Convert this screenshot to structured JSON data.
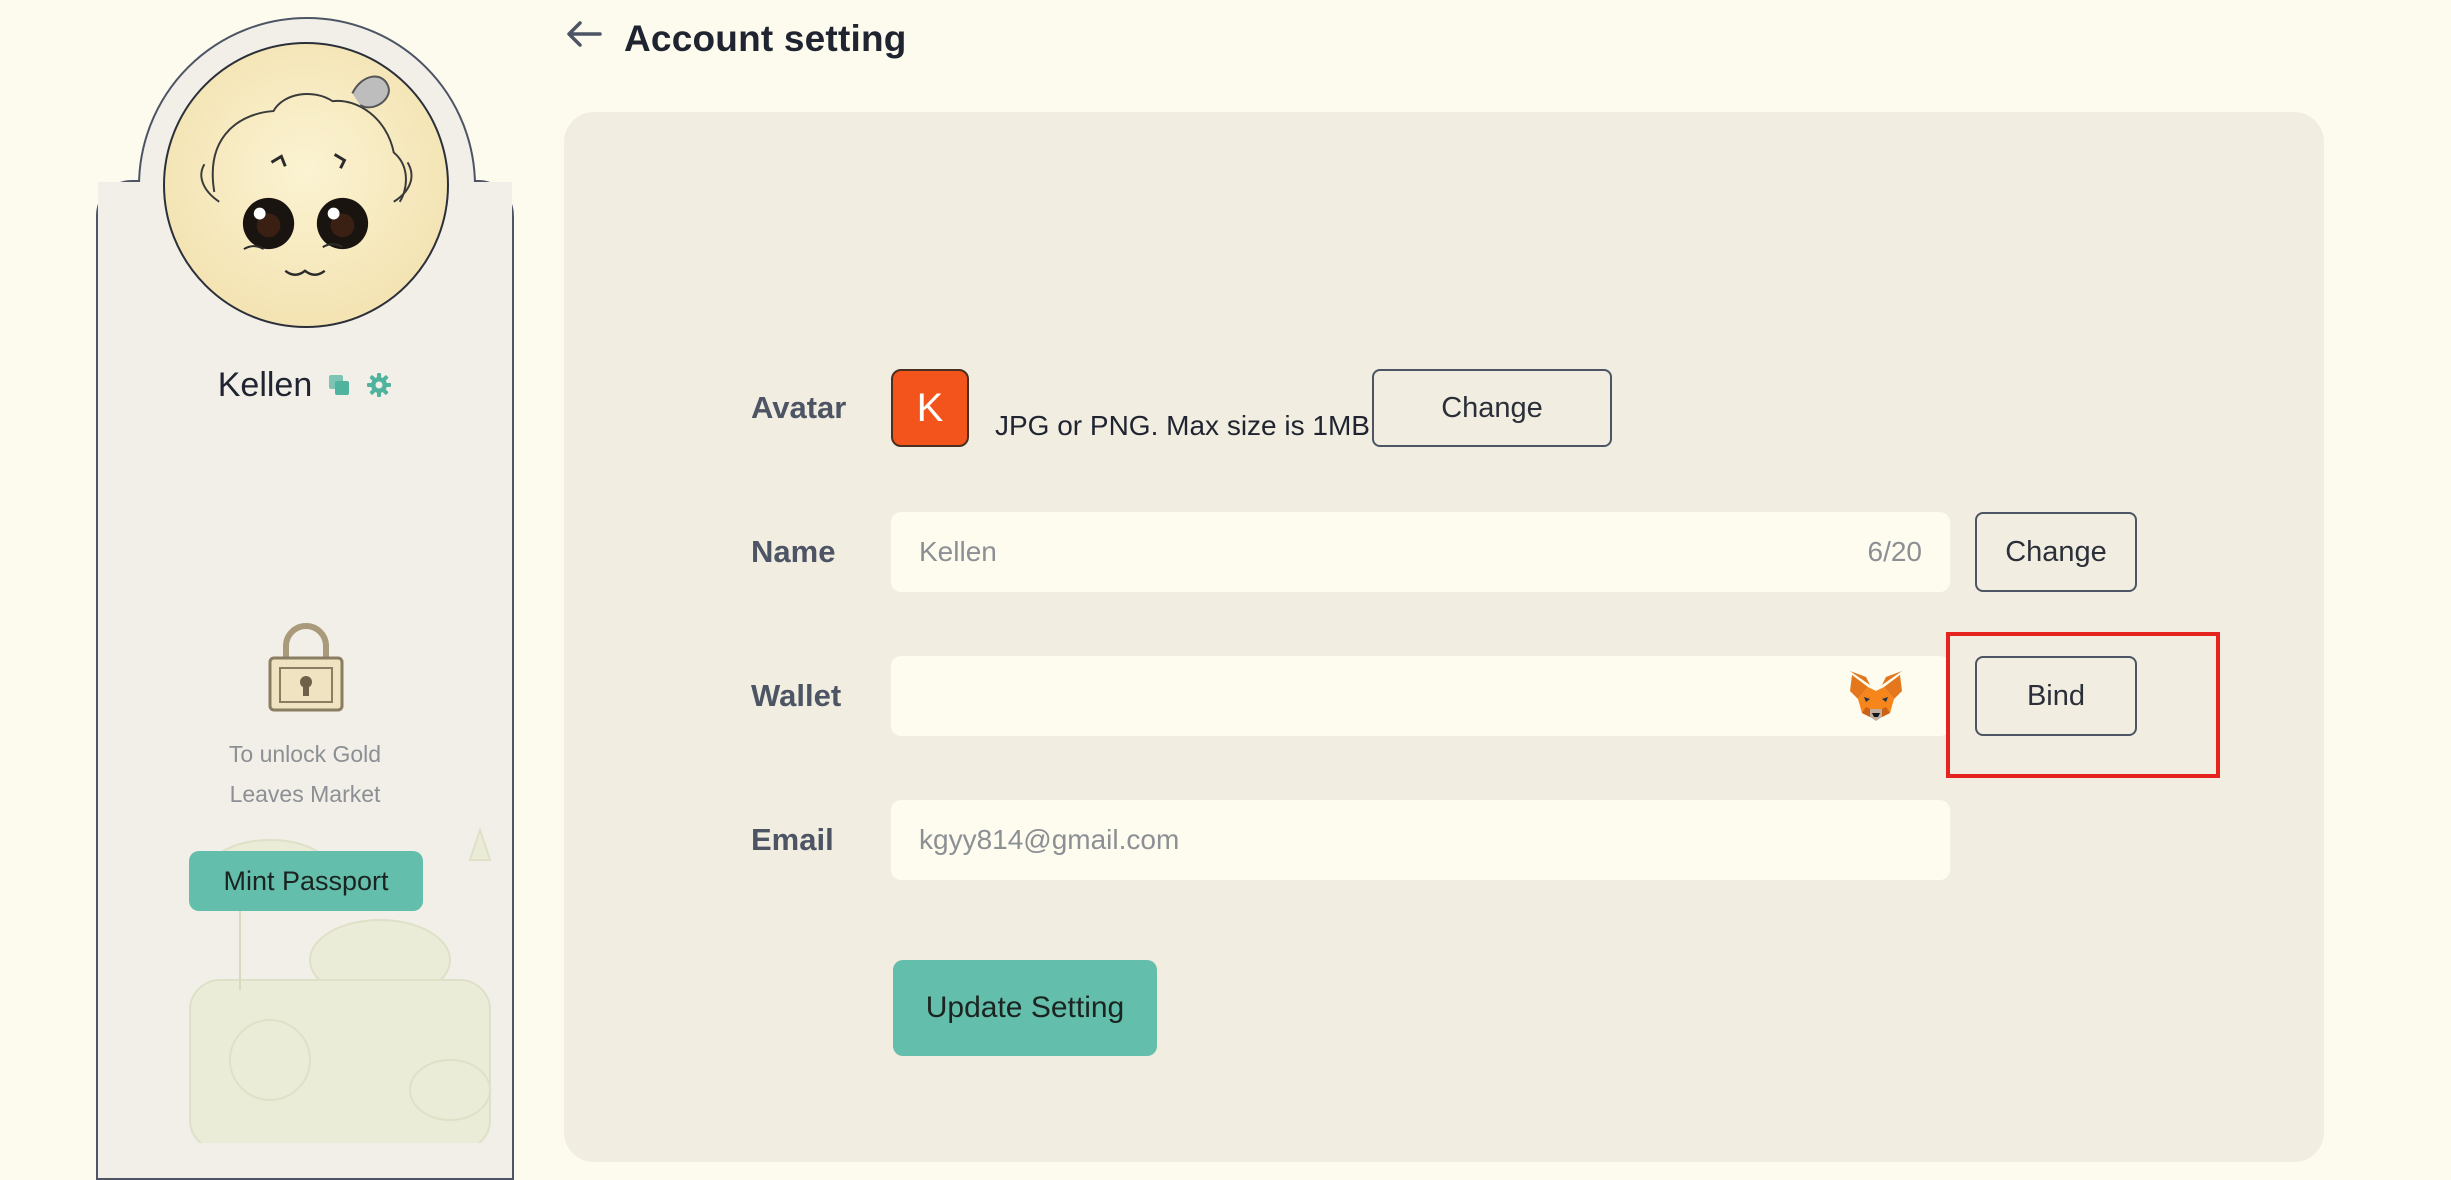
{
  "profile": {
    "username": "Kellen",
    "unlock_text_line1": "To unlock Gold",
    "unlock_text_line2": "Leaves Market",
    "mint_button_label": "Mint Passport",
    "icons": [
      "copy-icon",
      "gear-icon",
      "lock-icon"
    ]
  },
  "header": {
    "title": "Account setting",
    "back_icon": "arrow-left-icon"
  },
  "settings": {
    "avatar": {
      "label": "Avatar",
      "initial": "K",
      "hint": "JPG or PNG. Max size is 1MB",
      "button_label": "Change"
    },
    "name": {
      "label": "Name",
      "value": "Kellen",
      "counter": "6/20",
      "button_label": "Change"
    },
    "wallet": {
      "label": "Wallet",
      "value": "",
      "icon": "metamask-fox-icon",
      "button_label": "Bind"
    },
    "email": {
      "label": "Email",
      "value": "kgyy814@gmail.com"
    },
    "update_button_label": "Update Setting"
  },
  "colors": {
    "page_bg": "#fdfbee",
    "panel_bg": "#f1ede0",
    "accent": "#63bfab",
    "avatar_orange": "#f2541b",
    "highlight_red": "#e5231f"
  }
}
